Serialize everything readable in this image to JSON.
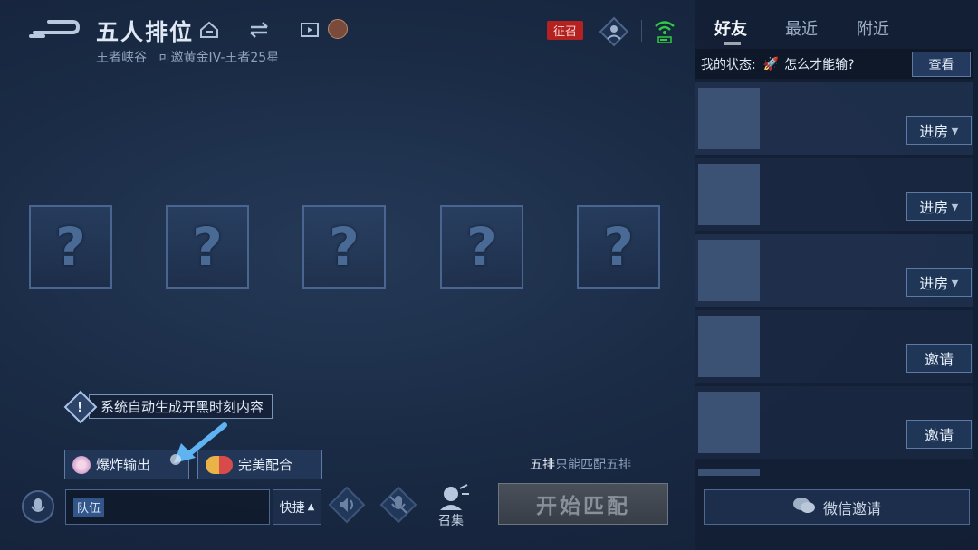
{
  "header": {
    "mode_title": "五人排位",
    "map_name": "王者峡谷",
    "rank_range": "可邀黄金IV-王者25星",
    "invite_tag": "征召"
  },
  "slots": [
    {
      "label": "?"
    },
    {
      "label": "?"
    },
    {
      "label": "?"
    },
    {
      "label": "?"
    },
    {
      "label": "?"
    }
  ],
  "tip": {
    "icon": "!",
    "text": "系统自动生成开黑时刻内容"
  },
  "moments": {
    "burst_label": "爆炸输出",
    "combo_label": "完美配合"
  },
  "five_note": {
    "prefix": "五排",
    "suffix": "只能匹配五排"
  },
  "chat": {
    "tag": "队伍",
    "quick_label": "快捷"
  },
  "summon_label": "召集",
  "start_label": "开始匹配",
  "friends_panel": {
    "tabs": [
      "好友",
      "最近",
      "附近"
    ],
    "status_prefix": "我的状态:",
    "status_text": "怎么才能输?",
    "view_label": "查看",
    "rows": [
      {
        "action": "进房"
      },
      {
        "action": "进房"
      },
      {
        "action": "进房"
      },
      {
        "action": "邀请"
      },
      {
        "action": "邀请"
      }
    ],
    "wechat_label": "微信邀请"
  },
  "colors": {
    "accent_red": "#b32121",
    "signal_green": "#2ecc40",
    "panel_bg": "#131f34"
  }
}
